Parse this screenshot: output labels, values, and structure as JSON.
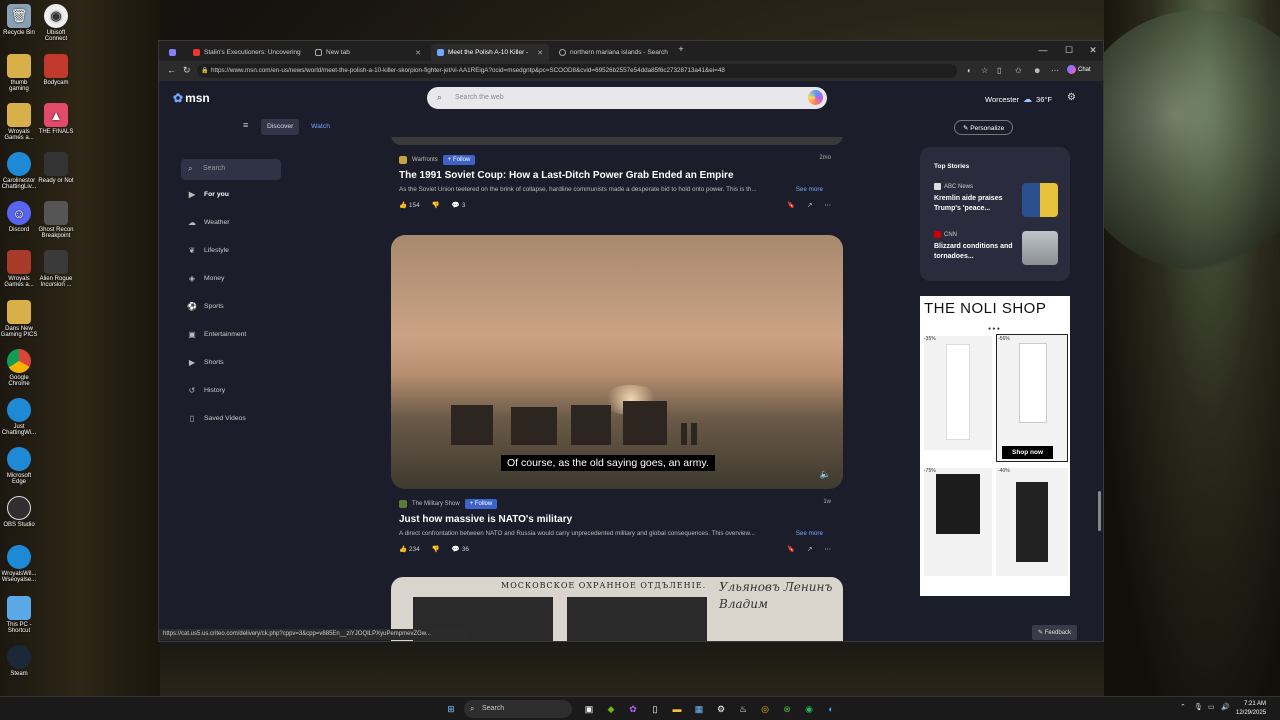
{
  "desktop": {
    "icons": [
      {
        "label": "Recycle Bin",
        "icon": "recycle-bin-icon"
      },
      {
        "label": "Ubisoft Connect",
        "icon": "ubisoft-icon"
      },
      {
        "label": "thumb gaming",
        "icon": "folder-icon"
      },
      {
        "label": "Bodycam",
        "icon": "game-icon"
      },
      {
        "label": "Wroyals Games a...",
        "icon": "folder-icon"
      },
      {
        "label": "THE FINALS",
        "icon": "game-icon"
      },
      {
        "label": "Carolinestor ChattingLiv...",
        "icon": "edge-icon"
      },
      {
        "label": "Ready or Not",
        "icon": "game-icon"
      },
      {
        "label": "Discord",
        "icon": "discord-icon"
      },
      {
        "label": "Ghost Recon Breakpoint",
        "icon": "game-icon"
      },
      {
        "label": "Wroyals Games a...",
        "icon": "folder-icon"
      },
      {
        "label": "Alien Rogue Incursion ...",
        "icon": "game-icon"
      },
      {
        "label": "Dans New Gaming PICS",
        "icon": "folder-icon"
      },
      {
        "label": "Google Chrome",
        "icon": "chrome-icon"
      },
      {
        "label": "Just ChattingWi...",
        "icon": "edge-icon"
      },
      {
        "label": "Microsoft Edge",
        "icon": "edge-icon"
      },
      {
        "label": "OBS Studio",
        "icon": "obs-icon"
      },
      {
        "label": "WroyalsWil... Wseoyalse...",
        "icon": "edge-icon"
      },
      {
        "label": "This PC - Shortcut",
        "icon": "pc-icon"
      },
      {
        "label": "Steam",
        "icon": "steam-icon"
      }
    ]
  },
  "browser": {
    "tabs": [
      {
        "label": "Stalin's Executioners: Uncovering",
        "active": false
      },
      {
        "label": "New tab",
        "active": false
      },
      {
        "label": "Meet the Polish A-10 Killer - ",
        "active": true
      },
      {
        "label": "northern mariana islands - Search",
        "active": false
      }
    ],
    "url": "https://www.msn.com/en-us/news/world/meet-the-polish-a-10-killer-skorpion-fighter-jet/vi-AA1REigA?ocid=msedgntp&pc=SCOOD8&cvid=69526b2557e54dda85f6c27328713a41&ei=48",
    "chat_label": "Chat",
    "status_url": "https://cat.us5.us.criteo.com/delivery/ck.php?cppv=3&cpp=v885En__ziYJOQILPXyuPempmevZGw..."
  },
  "msn": {
    "logo_text": "msn",
    "search_placeholder": "Search the web",
    "location": "Worcester",
    "temperature": "36°F",
    "subnav": {
      "discover": "Discover",
      "watch": "Watch",
      "personalize": "Personalize"
    },
    "sidebar": {
      "search_placeholder": "Search",
      "items": [
        {
          "label": "For you",
          "icon": "play-square-icon"
        },
        {
          "label": "Weather",
          "icon": "cloud-icon"
        },
        {
          "label": "Lifestyle",
          "icon": "lifestyle-icon"
        },
        {
          "label": "Money",
          "icon": "money-icon"
        },
        {
          "label": "Sports",
          "icon": "sports-icon"
        },
        {
          "label": "Entertainment",
          "icon": "entertainment-icon"
        },
        {
          "label": "Shorts",
          "icon": "shorts-icon"
        },
        {
          "label": "History",
          "icon": "history-icon"
        },
        {
          "label": "Saved Videos",
          "icon": "bookmark-icon"
        }
      ]
    },
    "feed": [
      {
        "source": "Warfronts",
        "follow": "Follow",
        "age": "2mo",
        "headline": "The 1991 Soviet Coup: How a Last-Ditch Power Grab Ended an Empire",
        "snippet": "As the Soviet Union teetered on the brink of collapse, hardline communists made a desperate bid to hold onto power. This is th...",
        "see_more": "See more",
        "likes": "154",
        "comments": "3"
      },
      {
        "source": "The Military Show",
        "follow": "Follow",
        "age": "1w",
        "caption": "Of course, as the old saying goes, an army.",
        "headline": "Just how massive is NATO's military",
        "snippet": "A direct confrontation between NATO and Russia would carry unprecedented military and global consequences. This overview...",
        "see_more": "See more",
        "likes": "234",
        "comments": "36"
      }
    ],
    "bottom_image_text": {
      "header": "МОСКОВСКОЕ ОХРАННОЕ ОТДЪЛЕНIЕ.",
      "script": "Ульяновъ Ленинъ Владим"
    },
    "top_stories": {
      "title": "Top Stories",
      "stories": [
        {
          "source": "ABC News",
          "headline": "Kremlin aide praises Trump's 'peace..."
        },
        {
          "source": "CNN",
          "headline": "Blizzard conditions and tornadoes..."
        }
      ]
    },
    "ad": {
      "title": "THE NOLI SHOP",
      "discounts": [
        "-35%",
        "-56%",
        "-75%",
        "-40%"
      ],
      "cta": "Shop now"
    },
    "feedback": "Feedback"
  },
  "taskbar": {
    "search_placeholder": "Search",
    "time": "7:21 AM",
    "date": "12/29/2025"
  }
}
